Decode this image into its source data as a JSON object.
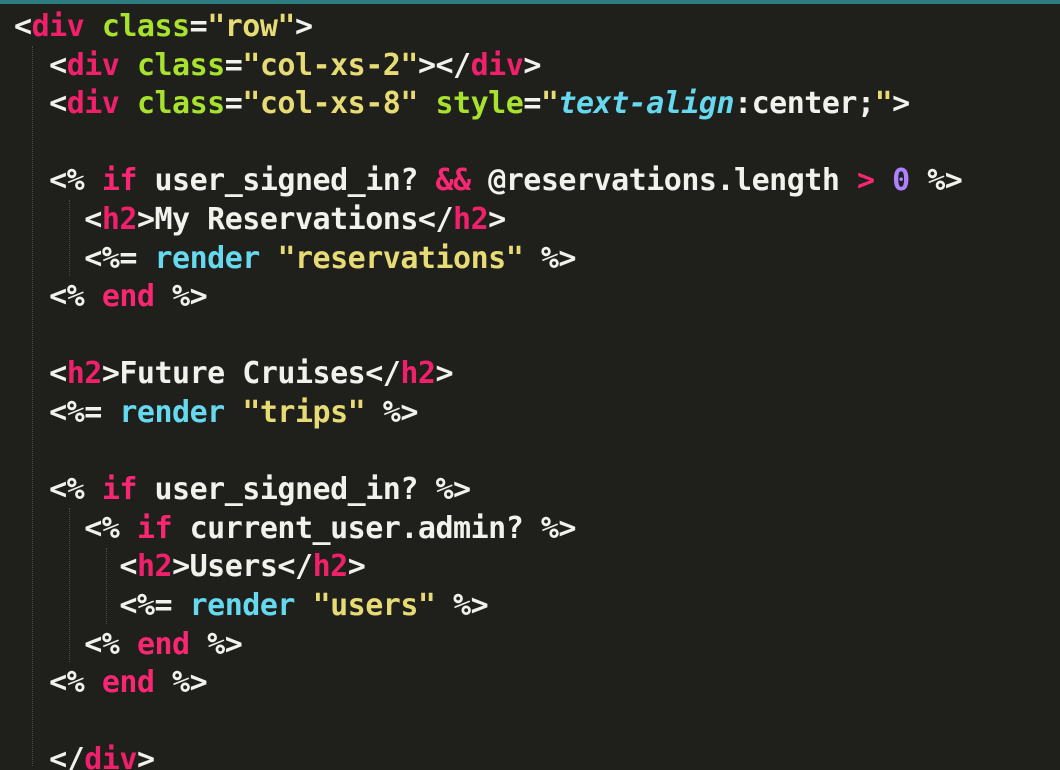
{
  "theme": {
    "background": "#1f1f1c",
    "top_bar": "#2d7d80",
    "plain": "#f2f2ec",
    "tag": "#f0206b",
    "attr": "#a6e22e",
    "string": "#e6db74",
    "keyword": "#f92672",
    "method": "#66d9ef",
    "number": "#ae81ff"
  },
  "code_lines": [
    {
      "indent": "",
      "tokens": [
        {
          "t": "<",
          "k": "plain"
        },
        {
          "t": "div",
          "k": "tag"
        },
        {
          "t": " ",
          "k": "plain"
        },
        {
          "t": "class",
          "k": "attr"
        },
        {
          "t": "=",
          "k": "plain"
        },
        {
          "t": "\"row\"",
          "k": "string"
        },
        {
          "t": ">",
          "k": "plain"
        }
      ]
    },
    {
      "indent": "  ",
      "tokens": [
        {
          "t": "<",
          "k": "plain"
        },
        {
          "t": "div",
          "k": "tag"
        },
        {
          "t": " ",
          "k": "plain"
        },
        {
          "t": "class",
          "k": "attr"
        },
        {
          "t": "=",
          "k": "plain"
        },
        {
          "t": "\"col-xs-2\"",
          "k": "string"
        },
        {
          "t": "></",
          "k": "plain"
        },
        {
          "t": "div",
          "k": "tag"
        },
        {
          "t": ">",
          "k": "plain"
        }
      ]
    },
    {
      "indent": "  ",
      "tokens": [
        {
          "t": "<",
          "k": "plain"
        },
        {
          "t": "div",
          "k": "tag"
        },
        {
          "t": " ",
          "k": "plain"
        },
        {
          "t": "class",
          "k": "attr"
        },
        {
          "t": "=",
          "k": "plain"
        },
        {
          "t": "\"col-xs-8\"",
          "k": "string"
        },
        {
          "t": " ",
          "k": "plain"
        },
        {
          "t": "style",
          "k": "attr"
        },
        {
          "t": "=",
          "k": "plain"
        },
        {
          "t": "\"",
          "k": "string"
        },
        {
          "t": "text-align",
          "k": "method_italic"
        },
        {
          "t": ":center;",
          "k": "plain"
        },
        {
          "t": "\"",
          "k": "string"
        },
        {
          "t": ">",
          "k": "plain"
        }
      ]
    },
    {
      "indent": "",
      "tokens": []
    },
    {
      "indent": "  ",
      "tokens": [
        {
          "t": "<%",
          "k": "plain"
        },
        {
          "t": " ",
          "k": "plain"
        },
        {
          "t": "if",
          "k": "keyword"
        },
        {
          "t": " user_signed_in? ",
          "k": "plain"
        },
        {
          "t": "&&",
          "k": "keyword"
        },
        {
          "t": " @reservations.length ",
          "k": "plain"
        },
        {
          "t": ">",
          "k": "keyword"
        },
        {
          "t": " ",
          "k": "plain"
        },
        {
          "t": "0",
          "k": "number"
        },
        {
          "t": " %>",
          "k": "plain"
        }
      ]
    },
    {
      "indent": "    ",
      "tokens": [
        {
          "t": "<",
          "k": "plain"
        },
        {
          "t": "h2",
          "k": "tag"
        },
        {
          "t": ">My Reservations</",
          "k": "plain"
        },
        {
          "t": "h2",
          "k": "tag"
        },
        {
          "t": ">",
          "k": "plain"
        }
      ]
    },
    {
      "indent": "    ",
      "tokens": [
        {
          "t": "<%=",
          "k": "plain"
        },
        {
          "t": " ",
          "k": "plain"
        },
        {
          "t": "render",
          "k": "method"
        },
        {
          "t": " ",
          "k": "plain"
        },
        {
          "t": "\"reservations\"",
          "k": "string"
        },
        {
          "t": " %>",
          "k": "plain"
        }
      ]
    },
    {
      "indent": "  ",
      "tokens": [
        {
          "t": "<%",
          "k": "plain"
        },
        {
          "t": " ",
          "k": "plain"
        },
        {
          "t": "end",
          "k": "keyword"
        },
        {
          "t": " %>",
          "k": "plain"
        }
      ]
    },
    {
      "indent": "",
      "tokens": []
    },
    {
      "indent": "  ",
      "tokens": [
        {
          "t": "<",
          "k": "plain"
        },
        {
          "t": "h2",
          "k": "tag"
        },
        {
          "t": ">Future Cruises</",
          "k": "plain"
        },
        {
          "t": "h2",
          "k": "tag"
        },
        {
          "t": ">",
          "k": "plain"
        }
      ]
    },
    {
      "indent": "  ",
      "tokens": [
        {
          "t": "<%=",
          "k": "plain"
        },
        {
          "t": " ",
          "k": "plain"
        },
        {
          "t": "render",
          "k": "method"
        },
        {
          "t": " ",
          "k": "plain"
        },
        {
          "t": "\"trips\"",
          "k": "string"
        },
        {
          "t": " %>",
          "k": "plain"
        }
      ]
    },
    {
      "indent": "",
      "tokens": []
    },
    {
      "indent": "  ",
      "tokens": [
        {
          "t": "<%",
          "k": "plain"
        },
        {
          "t": " ",
          "k": "plain"
        },
        {
          "t": "if",
          "k": "keyword"
        },
        {
          "t": " user_signed_in? %>",
          "k": "plain"
        }
      ]
    },
    {
      "indent": "    ",
      "tokens": [
        {
          "t": "<%",
          "k": "plain"
        },
        {
          "t": " ",
          "k": "plain"
        },
        {
          "t": "if",
          "k": "keyword"
        },
        {
          "t": " current_user.admin? %>",
          "k": "plain"
        }
      ]
    },
    {
      "indent": "      ",
      "tokens": [
        {
          "t": "<",
          "k": "plain"
        },
        {
          "t": "h2",
          "k": "tag"
        },
        {
          "t": ">Users</",
          "k": "plain"
        },
        {
          "t": "h2",
          "k": "tag"
        },
        {
          "t": ">",
          "k": "plain"
        }
      ]
    },
    {
      "indent": "      ",
      "tokens": [
        {
          "t": "<%=",
          "k": "plain"
        },
        {
          "t": " ",
          "k": "plain"
        },
        {
          "t": "render",
          "k": "method"
        },
        {
          "t": " ",
          "k": "plain"
        },
        {
          "t": "\"users\"",
          "k": "string"
        },
        {
          "t": " %>",
          "k": "plain"
        }
      ]
    },
    {
      "indent": "    ",
      "tokens": [
        {
          "t": "<%",
          "k": "plain"
        },
        {
          "t": " ",
          "k": "plain"
        },
        {
          "t": "end",
          "k": "keyword"
        },
        {
          "t": " %>",
          "k": "plain"
        }
      ]
    },
    {
      "indent": "  ",
      "tokens": [
        {
          "t": "<%",
          "k": "plain"
        },
        {
          "t": " ",
          "k": "plain"
        },
        {
          "t": "end",
          "k": "keyword"
        },
        {
          "t": " %>",
          "k": "plain"
        }
      ]
    },
    {
      "indent": "",
      "tokens": []
    },
    {
      "indent": "  ",
      "tokens": [
        {
          "t": "</",
          "k": "plain"
        },
        {
          "t": "div",
          "k": "tag"
        },
        {
          "t": ">",
          "k": "plain"
        }
      ]
    }
  ]
}
